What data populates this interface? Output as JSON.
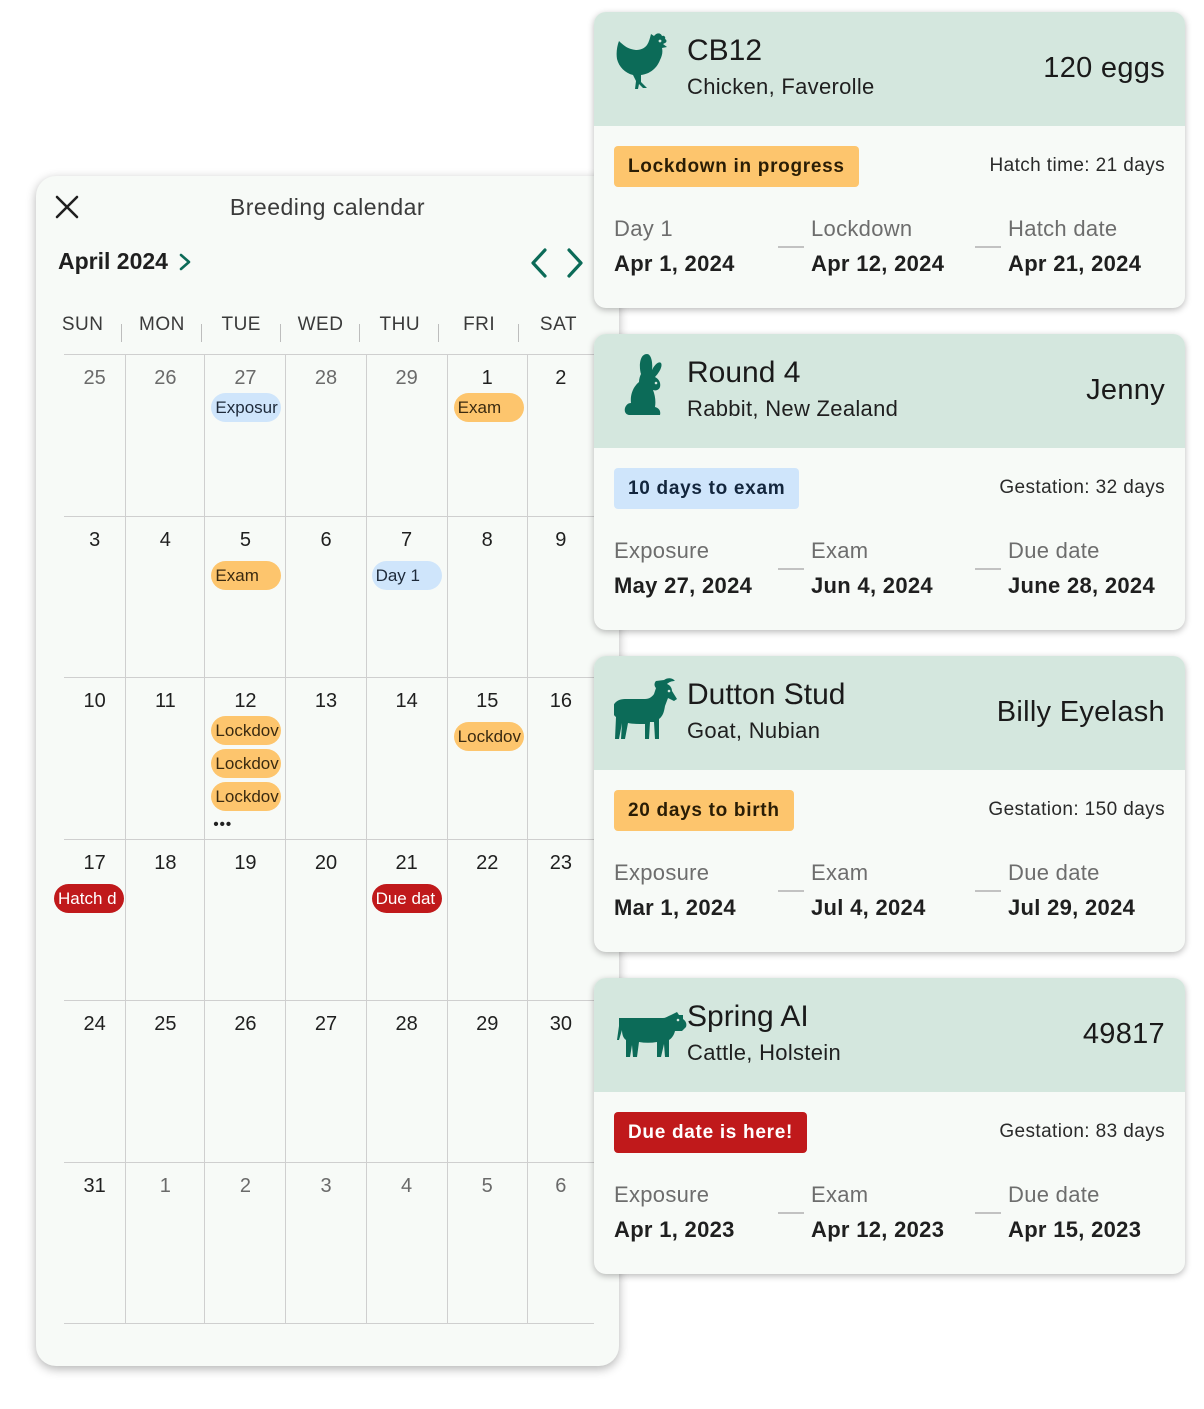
{
  "calendar": {
    "title": "Breeding calendar",
    "month": "April 2024",
    "weekdays": [
      "SUN",
      "MON",
      "TUE",
      "WED",
      "THU",
      "FRI",
      "SAT"
    ],
    "weeks": [
      [
        "25",
        "26",
        "27",
        "28",
        "29",
        "1",
        "2"
      ],
      [
        "3",
        "4",
        "5",
        "6",
        "7",
        "8",
        "9"
      ],
      [
        "10",
        "11",
        "12",
        "13",
        "14",
        "15",
        "16"
      ],
      [
        "17",
        "18",
        "19",
        "20",
        "21",
        "22",
        "23"
      ],
      [
        "24",
        "25",
        "26",
        "27",
        "28",
        "29",
        "30"
      ],
      [
        "31",
        "1",
        "2",
        "3",
        "4",
        "5",
        "6"
      ]
    ],
    "events": {
      "exposure": "Exposur",
      "exam": "Exam",
      "day1": "Day 1",
      "lockdown": "Lockdov",
      "hatch": "Hatch d",
      "due": "Due dat",
      "more": "•••"
    }
  },
  "cards": [
    {
      "name": "CB12",
      "breed": "Chicken, Faverolle",
      "right": "120 eggs",
      "icon": "chicken-icon",
      "status": "Lockdown in progress",
      "status_color": "#fdc56d",
      "period": "Hatch time: 21 days",
      "dates": [
        {
          "label": "Day 1",
          "value": "Apr 1, 2024"
        },
        {
          "label": "Lockdown",
          "value": "Apr 12, 2024"
        },
        {
          "label": "Hatch date",
          "value": "Apr 21, 2024"
        }
      ]
    },
    {
      "name": "Round 4",
      "breed": "Rabbit, New Zealand",
      "right": "Jenny",
      "icon": "rabbit-icon",
      "status": "10 days to exam",
      "status_color": "#cfe5fb",
      "period": "Gestation: 32 days",
      "dates": [
        {
          "label": "Exposure",
          "value": "May 27, 2024"
        },
        {
          "label": "Exam",
          "value": "Jun 4, 2024"
        },
        {
          "label": "Due date",
          "value": "June 28, 2024"
        }
      ]
    },
    {
      "name": "Dutton Stud",
      "breed": "Goat, Nubian",
      "right": "Billy Eyelash",
      "icon": "goat-icon",
      "status": "20 days to birth",
      "status_color": "#fdc56d",
      "period": "Gestation: 150 days",
      "dates": [
        {
          "label": "Exposure",
          "value": "Mar 1, 2024"
        },
        {
          "label": "Exam",
          "value": "Jul 4, 2024"
        },
        {
          "label": "Due date",
          "value": "Jul 29, 2024"
        }
      ]
    },
    {
      "name": "Spring AI",
      "breed": "Cattle, Holstein",
      "right": "49817",
      "icon": "cow-icon",
      "status": "Due date is here!",
      "status_color": "#c0191b",
      "period": "Gestation: 83 days",
      "dates": [
        {
          "label": "Exposure",
          "value": "Apr 1, 2023"
        },
        {
          "label": "Exam",
          "value": "Apr 12, 2023"
        },
        {
          "label": "Due date",
          "value": "Apr 15, 2023"
        }
      ]
    }
  ],
  "colors": {
    "accent": "#0c6b58",
    "card_header": "#d4e7de",
    "panel_bg": "#f7faf7",
    "chip_blue": "#cfe5fb",
    "chip_orange": "#fdc56d",
    "chip_red": "#c0191b"
  }
}
